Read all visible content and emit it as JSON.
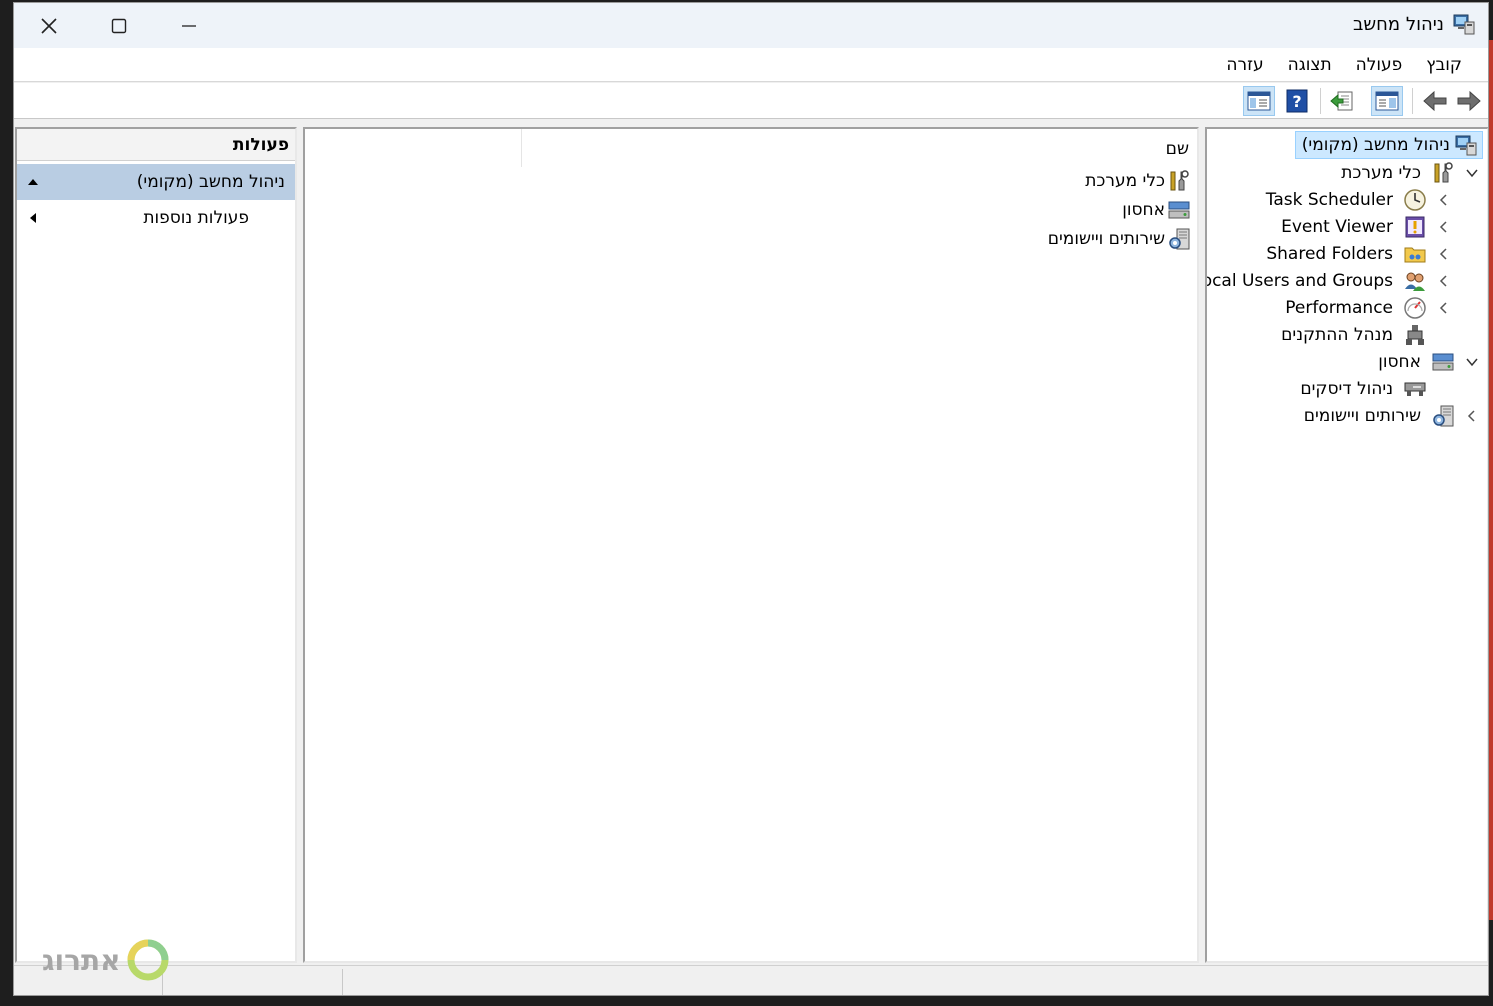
{
  "window": {
    "title": "ניהול מחשב"
  },
  "menu": {
    "items": [
      "קובץ",
      "פעולה",
      "תצוגה",
      "עזרה"
    ]
  },
  "toolbar": {
    "buttons": [
      "back-arrow-icon",
      "forward-arrow-icon",
      "show-hide-console-tree-icon",
      "export-list-icon",
      "help-icon",
      "show-hide-action-pane-icon"
    ]
  },
  "tree": {
    "root": "ניהול מחשב (מקומי)",
    "system_tools": "כלי מערכת",
    "task_scheduler": "Task Scheduler",
    "event_viewer": "Event Viewer",
    "shared_folders": "Shared Folders",
    "local_users": "Local Users and Groups",
    "performance": "Performance",
    "device_manager": "מנהל ההתקנים",
    "storage": "אחסון",
    "disk_management": "ניהול דיסקים",
    "services_apps": "שירותים ויישומים"
  },
  "center": {
    "column_header": "שם",
    "items": [
      "כלי מערכת",
      "אחסון",
      "שירותים ויישומים"
    ]
  },
  "actions": {
    "header": "פעולות",
    "section": "ניהול מחשב (מקומי)",
    "more": "פעולות נוספות"
  },
  "watermark": {
    "text": "אתרוג"
  },
  "colors": {
    "selection": "#cce8ff",
    "action_selected": "#b9cde3",
    "pane_border": "#a0a0a0"
  }
}
